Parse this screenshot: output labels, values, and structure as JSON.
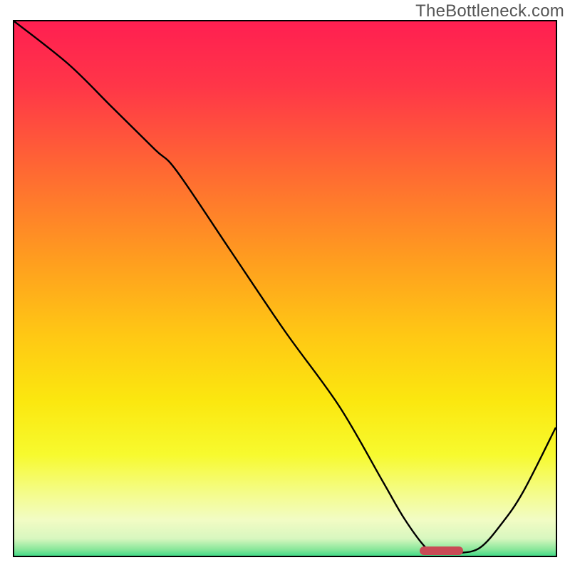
{
  "watermark": "TheBottleneck.com",
  "chart_data": {
    "type": "line",
    "title": "",
    "xlabel": "",
    "ylabel": "",
    "xlim": [
      0,
      100
    ],
    "ylim": [
      0,
      100
    ],
    "grid": false,
    "legend": false,
    "gradient_stops": [
      {
        "offset": 0,
        "color": "#ff1f51"
      },
      {
        "offset": 0.12,
        "color": "#ff3648"
      },
      {
        "offset": 0.28,
        "color": "#ff6a32"
      },
      {
        "offset": 0.44,
        "color": "#ff9d1f"
      },
      {
        "offset": 0.58,
        "color": "#ffc814"
      },
      {
        "offset": 0.7,
        "color": "#fbe70f"
      },
      {
        "offset": 0.8,
        "color": "#f7fa2e"
      },
      {
        "offset": 0.875,
        "color": "#f4fc8f"
      },
      {
        "offset": 0.92,
        "color": "#f2fcc4"
      },
      {
        "offset": 0.955,
        "color": "#d8f7bf"
      },
      {
        "offset": 0.975,
        "color": "#8ae79a"
      },
      {
        "offset": 0.995,
        "color": "#13d17b"
      },
      {
        "offset": 1.0,
        "color": "#0fcd77"
      }
    ],
    "series": [
      {
        "name": "bottleneck-curve",
        "color": "#000000",
        "x": [
          0,
          10,
          18,
          26,
          30,
          40,
          50,
          60,
          68,
          72,
          76,
          78,
          82,
          86,
          90,
          94,
          100
        ],
        "y": [
          100,
          92,
          84,
          76,
          72,
          57,
          42,
          28,
          14,
          7,
          1.5,
          0.5,
          0.5,
          1.5,
          6,
          12,
          24
        ]
      }
    ],
    "floor_marker": {
      "x_start": 75,
      "x_end": 83,
      "y": 0.6,
      "color": "#c94a55"
    }
  }
}
